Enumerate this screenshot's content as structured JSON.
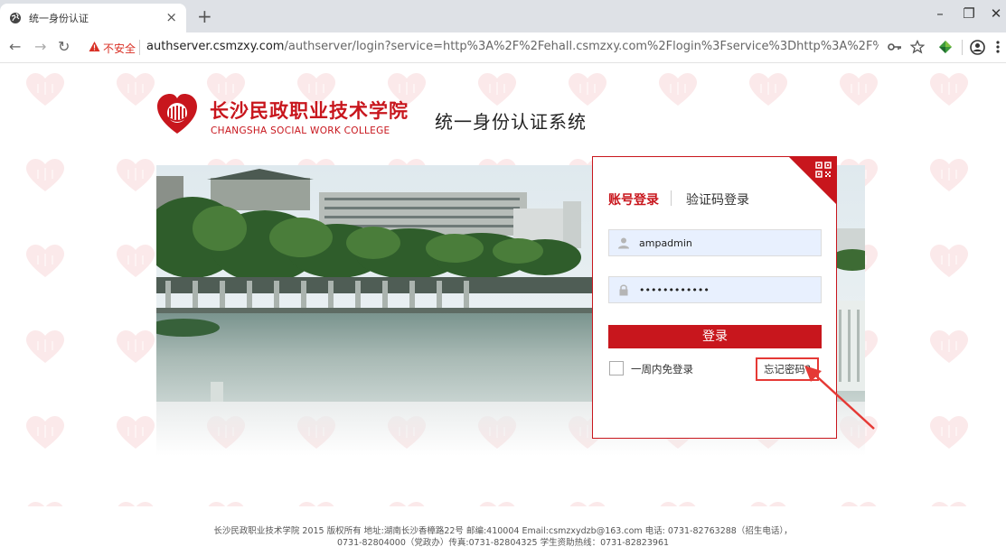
{
  "browser": {
    "tab_title": "统一身份认证",
    "new_tab_symbol": "+",
    "security_label": "不安全",
    "url_host": "authserver.csmzxy.com",
    "url_rest": "/authserver/login?service=http%3A%2F%2Fehall.csmzxy.com%2Flogin%3Fservice%3Dhttp%3A%2F%2Fehall.csmzxy.co...",
    "icons": [
      "globe-icon",
      "close-icon",
      "back-icon",
      "forward-icon",
      "reload-icon",
      "warning-icon",
      "key-icon",
      "star-icon",
      "extension-icon",
      "profile-icon",
      "menu-icon"
    ]
  },
  "header": {
    "school_name_cn": "长沙民政职业技术学院",
    "school_name_en": "CHANGSHA SOCIAL WORK COLLEGE",
    "system_title": "统一身份认证系统"
  },
  "login": {
    "tab_account": "账号登录",
    "tab_code": "验证码登录",
    "username": "ampadmin",
    "password": "••••••••••••",
    "submit_label": "登录",
    "remember_label": "一周内免登录",
    "forgot_label": "忘记密码?"
  },
  "footer": {
    "line1": "长沙民政职业技术学院 2015 版权所有 地址:湖南长沙香樟路22号 邮编:410004 Email:csmzxydzb@163.com 电话: 0731-82763288（招生电话），",
    "line2": "0731-82804000（党政办）传真:0731-82804325 学生资助热线：0731-82823961"
  },
  "colors": {
    "brand_red": "#c8161d",
    "annotation_red": "#e53935",
    "input_bg": "#e8f0fe"
  }
}
